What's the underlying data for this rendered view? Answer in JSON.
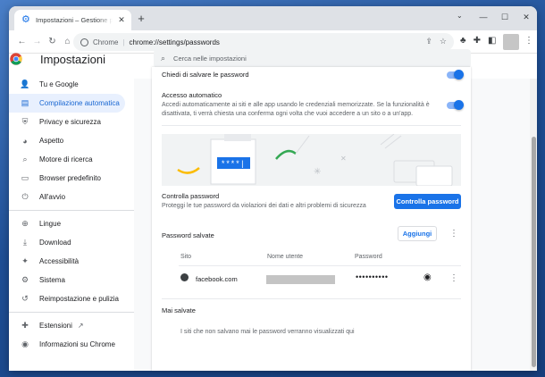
{
  "tab": {
    "title": "Impostazioni – Gestione password",
    "close": "✕",
    "new_tab": "+"
  },
  "window_controls": {
    "minimize": "—",
    "maximize": "☐",
    "close": "✕",
    "tab_search": "⌄"
  },
  "omnibox": {
    "site_label": "Chrome",
    "separator": "|",
    "url": "chrome://settings/passwords"
  },
  "header": {
    "title": "Impostazioni",
    "search_placeholder": "Cerca nelle impostazioni"
  },
  "sidebar": {
    "items": [
      {
        "label": "Tu e Google",
        "icon": "person-icon",
        "glyph": "👤"
      },
      {
        "label": "Compilazione automatica",
        "icon": "clipboard-icon",
        "glyph": "▤",
        "active": true
      },
      {
        "label": "Privacy e sicurezza",
        "icon": "shield-icon",
        "glyph": "⛨"
      },
      {
        "label": "Aspetto",
        "icon": "palette-icon",
        "glyph": "◕"
      },
      {
        "label": "Motore di ricerca",
        "icon": "search-icon",
        "glyph": "⌕"
      },
      {
        "label": "Browser predefinito",
        "icon": "browser-icon",
        "glyph": "▭"
      },
      {
        "label": "All'avvio",
        "icon": "power-icon",
        "glyph": "⏻"
      }
    ],
    "items2": [
      {
        "label": "Lingue",
        "icon": "globe-icon",
        "glyph": "⊕"
      },
      {
        "label": "Download",
        "icon": "download-icon",
        "glyph": "⤓"
      },
      {
        "label": "Accessibilità",
        "icon": "accessibility-icon",
        "glyph": "✦"
      },
      {
        "label": "Sistema",
        "icon": "wrench-icon",
        "glyph": "⚙"
      },
      {
        "label": "Reimpostazione e pulizia",
        "icon": "reset-icon",
        "glyph": "↺"
      }
    ],
    "items3": [
      {
        "label": "Estensioni",
        "icon": "puzzle-icon",
        "glyph": "✚",
        "external": "↗"
      },
      {
        "label": "Informazioni su Chrome",
        "icon": "chrome-icon",
        "glyph": "◉"
      }
    ]
  },
  "main": {
    "offer_save": "Chiedi di salvare le password",
    "auto_signin": {
      "title": "Accesso automatico",
      "desc1": "Accedi automaticamente ai siti e alle app usando le credenziali memorizzate. Se la funzionalità è",
      "desc2": "disattivata, ti verrà chiesta una conferma ogni volta che vuoi accedere a un sito o a un'app."
    },
    "illustration_pw": "****|",
    "check": {
      "title": "Controlla password",
      "desc": "Proteggi le tue password da violazioni dei dati e altri problemi di sicurezza",
      "button": "Controlla password"
    },
    "saved": {
      "title": "Password salvate",
      "add_button": "Aggiungi",
      "columns": [
        "Sito",
        "Nome utente",
        "Password"
      ],
      "rows": [
        {
          "site": "facebook.com",
          "password": "••••••••••"
        }
      ]
    },
    "never": {
      "title": "Mai salvate",
      "empty": "I siti che non salvano mai le password verranno visualizzati qui"
    }
  }
}
